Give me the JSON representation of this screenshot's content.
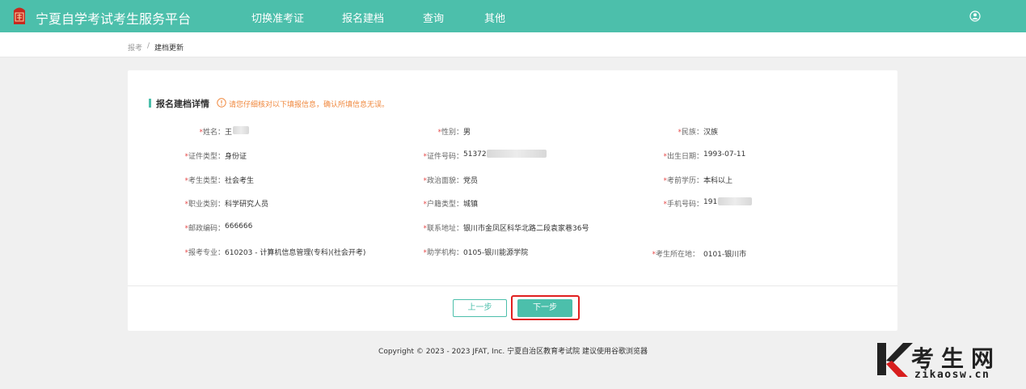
{
  "header": {
    "brand": "宁夏自学考试考生服务平台",
    "nav": [
      "切换准考证",
      "报名建档",
      "查询",
      "其他"
    ],
    "logo_icon": "seal-logo-icon",
    "user_icon": "user-avatar-icon"
  },
  "breadcrumb": {
    "home": "报考",
    "separator": "/",
    "current": "建档更新"
  },
  "section": {
    "title": "报名建档详情",
    "notice": "请您仔细核对以下填报信息，确认所填信息无误。",
    "notice_icon": "info-circle-icon"
  },
  "required_mark": "*",
  "fields": {
    "name": {
      "label": "姓名：",
      "value": "王"
    },
    "gender": {
      "label": "性别：",
      "value": "男"
    },
    "ethnicity": {
      "label": "民族：",
      "value": "汉族"
    },
    "id_type": {
      "label": "证件类型：",
      "value": "身份证"
    },
    "id_number": {
      "label": "证件号码：",
      "value": "51372"
    },
    "birth_date": {
      "label": "出生日期：",
      "value": "1993-07-11"
    },
    "candidate_type": {
      "label": "考生类型：",
      "value": "社会考生"
    },
    "political_status": {
      "label": "政治面貌：",
      "value": "党员"
    },
    "prior_education": {
      "label": "考前学历：",
      "value": "本科以上"
    },
    "occupation": {
      "label": "职业类别：",
      "value": "科学研究人员"
    },
    "household_type": {
      "label": "户籍类型：",
      "value": "城镇"
    },
    "phone": {
      "label": "手机号码：",
      "value": "191"
    },
    "postal_code": {
      "label": "邮政编码：",
      "value": "666666"
    },
    "address": {
      "label": "联系地址：",
      "value": "银川市金凤区科华北路二段袁家巷36号"
    },
    "major": {
      "label": "报考专业：",
      "value": "610203 - 计算机信息管理(专科)(社会开考)"
    },
    "assist_org": {
      "label": "助学机构：",
      "value": "0105-银川能源学院"
    },
    "exam_location": {
      "label": "考生所在地：",
      "value": "0101-银川市"
    }
  },
  "buttons": {
    "prev": "上一步",
    "next": "下一步"
  },
  "footer": "Copyright © 2023 - 2023 JFAT, Inc. 宁夏自治区教育考试院 建议使用谷歌浏览器",
  "watermark": {
    "cn": "考生网",
    "url": "zikaosw.cn",
    "icon": "k-logo-icon"
  },
  "colors": {
    "primary": "#4cbfab",
    "required": "#e64b4b",
    "warning": "#f0883e",
    "highlight": "#e02020"
  }
}
